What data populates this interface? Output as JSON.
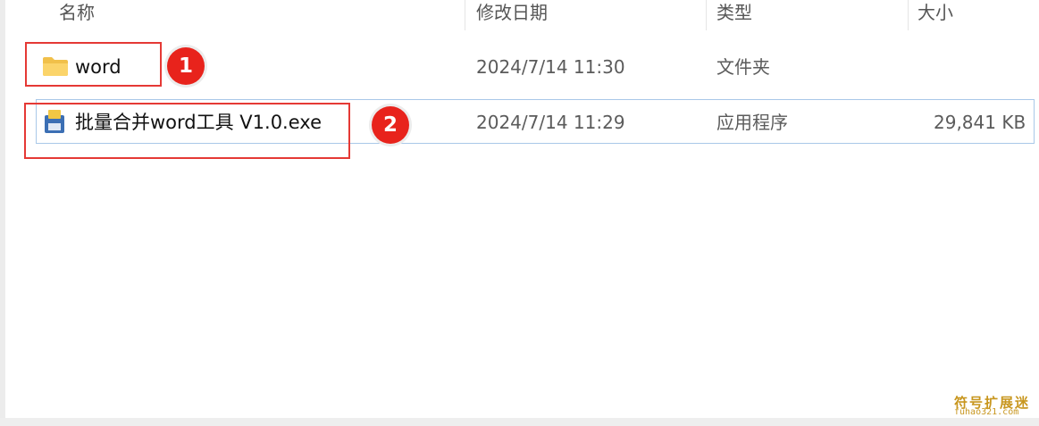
{
  "columns": {
    "name": "名称",
    "modified": "修改日期",
    "type": "类型",
    "size": "大小"
  },
  "files": [
    {
      "name": "word",
      "modified": "2024/7/14 11:30",
      "type": "文件夹",
      "size": "",
      "icon": "folder-icon"
    },
    {
      "name": "批量合并word工具 V1.0.exe",
      "modified": "2024/7/14 11:29",
      "type": "应用程序",
      "size": "29,841 KB",
      "icon": "exe-icon"
    }
  ],
  "annotations": {
    "badge1": "1",
    "badge2": "2",
    "annotation_color": "#e53935"
  },
  "watermark": {
    "line1": "符号扩展迷",
    "line2": "fuhao321.com",
    "color": "#c8961e"
  }
}
